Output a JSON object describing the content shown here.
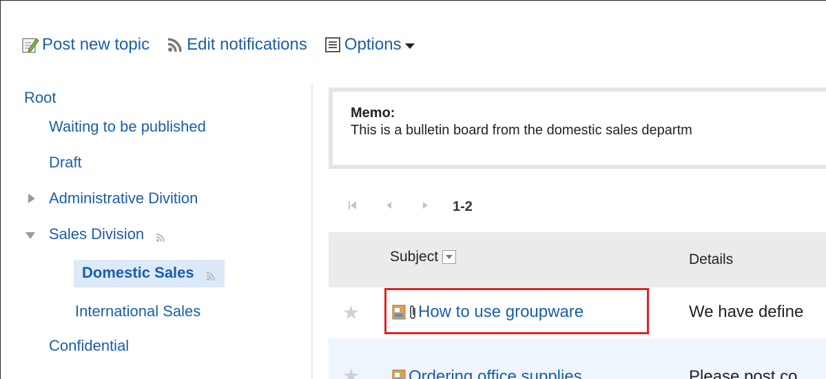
{
  "toolbar": {
    "post_new_topic": "Post new topic",
    "edit_notifications": "Edit notifications",
    "options": "Options"
  },
  "tree": {
    "root": "Root",
    "waiting": "Waiting to be published",
    "draft": "Draft",
    "administrative": "Administrative Divition",
    "sales": "Sales Division",
    "domestic": "Domestic Sales",
    "international": "International Sales",
    "confidential": "Confidential"
  },
  "memo": {
    "title": "Memo:",
    "text": "This is a bulletin board from the domestic sales departm"
  },
  "pager": {
    "range": "1-2"
  },
  "table": {
    "columns": {
      "subject": "Subject",
      "details": "Details"
    },
    "rows": [
      {
        "subject": "How to use groupware",
        "details": "We have define"
      },
      {
        "subject": "Ordering office supplies",
        "details": "Please post co"
      }
    ]
  },
  "colors": {
    "link": "#1a5ea8",
    "highlight": "#e41e1e",
    "selected_bg": "#dce9f7",
    "header_bg": "#ebebeb"
  }
}
